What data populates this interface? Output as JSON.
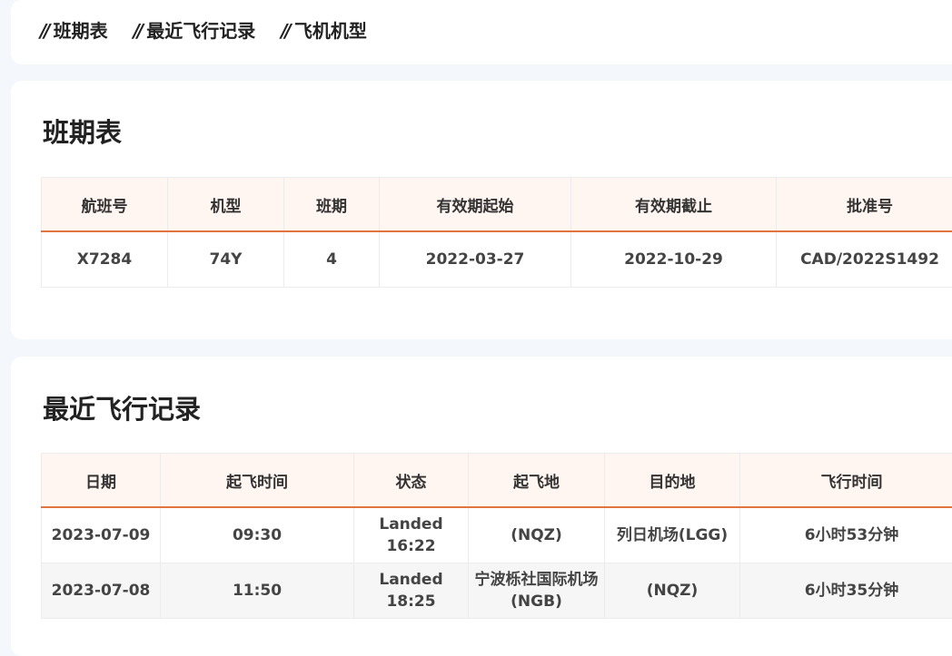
{
  "nav": {
    "tabs": [
      {
        "slash": "//",
        "label": "班期表"
      },
      {
        "slash": "//",
        "label": "最近飞行记录"
      },
      {
        "slash": "//",
        "label": "飞机机型"
      }
    ]
  },
  "schedule": {
    "title": "班期表",
    "columns": [
      "航班号",
      "机型",
      "班期",
      "有效期起始",
      "有效期截止",
      "批准号"
    ],
    "rows": [
      [
        "X7284",
        "74Y",
        "4",
        "2022-03-27",
        "2022-10-29",
        "CAD/2022S1492"
      ]
    ]
  },
  "recent": {
    "title": "最近飞行记录",
    "columns": [
      "日期",
      "起飞时间",
      "状态",
      "起飞地",
      "目的地",
      "飞行时间"
    ],
    "rows": [
      [
        "2023-07-09",
        "09:30",
        "Landed 16:22",
        "(NQZ)",
        "列日机场(LGG)",
        "6小时53分钟"
      ],
      [
        "2023-07-08",
        "11:50",
        "Landed 18:25",
        "宁波栎社国际机场(NGB)",
        "(NQZ)",
        "6小时35分钟"
      ]
    ]
  },
  "colors": {
    "accent": "#e2743f",
    "header_bg": "#fff5f1",
    "page_bg": "#f4f7fb"
  }
}
